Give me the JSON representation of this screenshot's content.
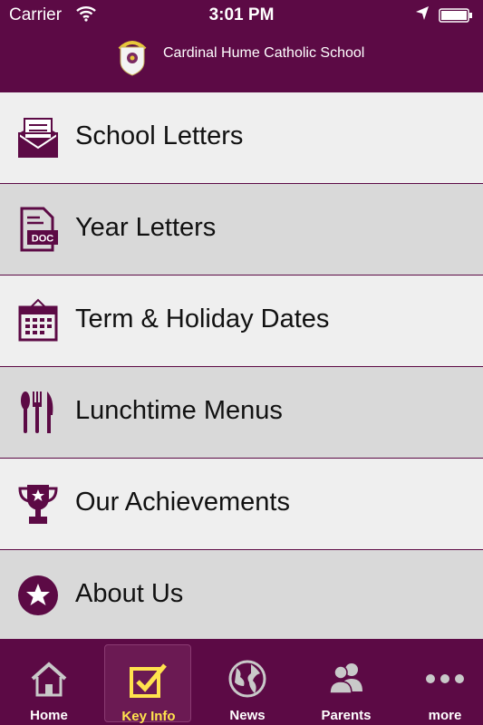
{
  "status_bar": {
    "carrier": "Carrier",
    "time": "3:01 PM"
  },
  "header": {
    "title": "Cardinal Hume Catholic School"
  },
  "colors": {
    "brand": "#5c0a45",
    "active_tab": "#ffe34d",
    "row_light": "#efefef",
    "row_dark": "#d9d9d9"
  },
  "menu": {
    "items": [
      {
        "label": "School Letters",
        "icon": "envelope-icon"
      },
      {
        "label": "Year Letters",
        "icon": "doc-icon"
      },
      {
        "label": "Term & Holiday Dates",
        "icon": "calendar-icon"
      },
      {
        "label": "Lunchtime Menus",
        "icon": "cutlery-icon"
      },
      {
        "label": "Our Achievements",
        "icon": "trophy-icon"
      },
      {
        "label": "About Us",
        "icon": "star-circle-icon"
      }
    ]
  },
  "tabbar": {
    "tabs": [
      {
        "label": "Home",
        "icon": "home-icon"
      },
      {
        "label": "Key Info",
        "icon": "checkbox-icon",
        "active": true
      },
      {
        "label": "News",
        "icon": "globe-icon"
      },
      {
        "label": "Parents",
        "icon": "people-icon"
      },
      {
        "label": "more",
        "icon": "more-icon"
      }
    ]
  }
}
